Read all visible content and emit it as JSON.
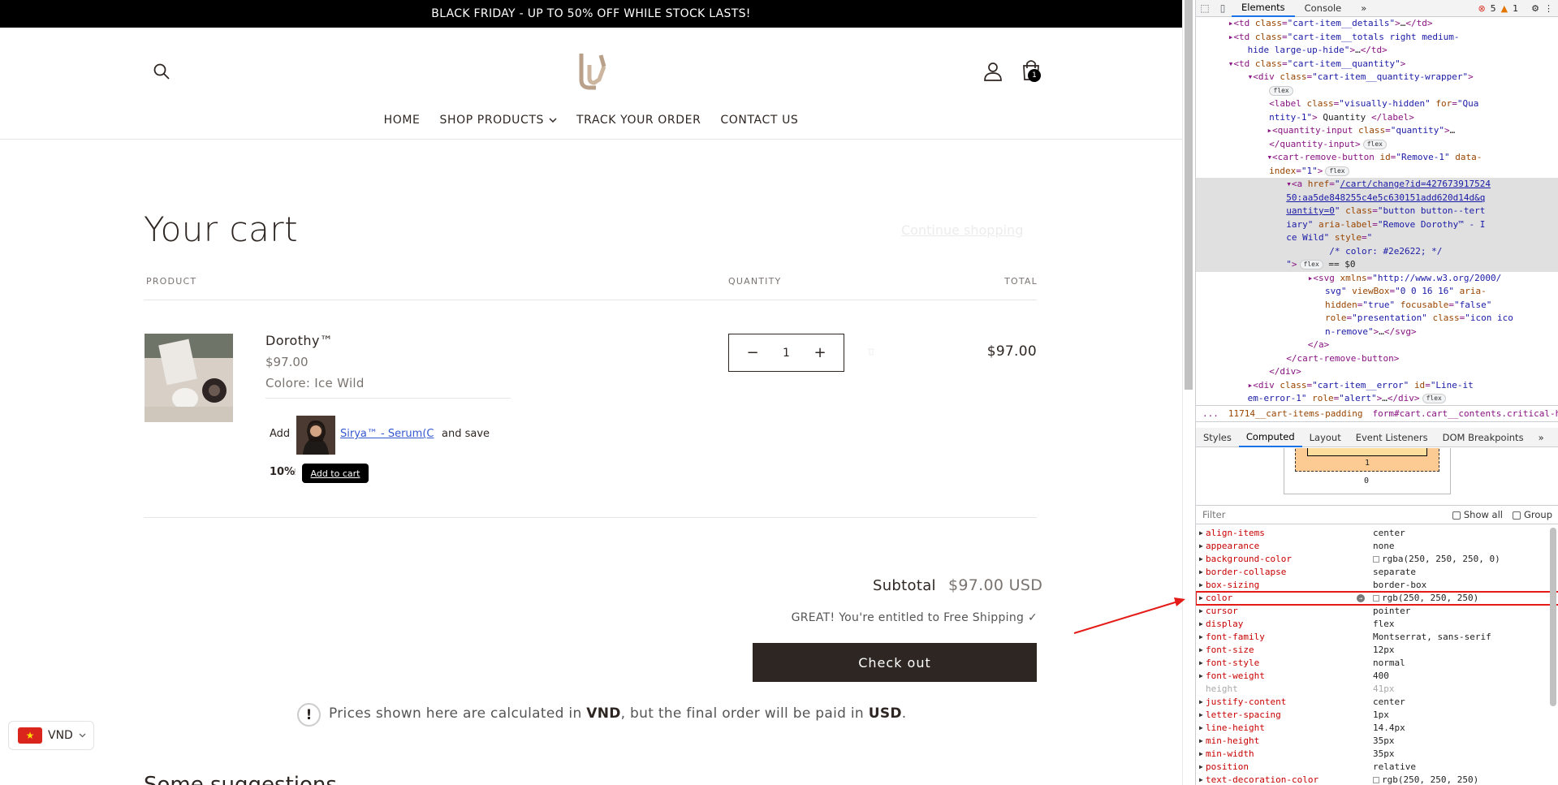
{
  "store": {
    "announcement": "BLACK FRIDAY - UP TO 50% OFF WHILE STOCK LASTS!",
    "nav": [
      "HOME",
      "SHOP PRODUCTS",
      "TRACK YOUR ORDER",
      "CONTACT US"
    ],
    "cart_count": "1",
    "title": "Your cart",
    "continue_shopping": "Continue shopping",
    "headers": {
      "product": "PRODUCT",
      "quantity": "QUANTITY",
      "total": "TOTAL"
    },
    "item": {
      "name": "Dorothy™",
      "price": "$97.00",
      "variant": "Colore: Ice Wild",
      "quantity": "1",
      "line_total": "$97.00"
    },
    "upsell": {
      "add": "Add",
      "product_link": "Sirya™ - Serum(C",
      "and_save": "and save",
      "discount": "10%",
      "separator": "!",
      "button": "Add to cart"
    },
    "subtotal_label": "Subtotal",
    "subtotal_value": "$97.00 USD",
    "shipping_message": "GREAT! You're entitled to Free Shipping ✓",
    "checkout": "Check out",
    "notice": {
      "pre": "Prices shown here are calculated in ",
      "cur1": "VND",
      "mid": ", but the final order will be paid in ",
      "cur2": "USD",
      "end": "."
    },
    "next_heading": "Some suggestions",
    "currency": "VND",
    "colors": {
      "checkout_bg": "#2e2622",
      "announce_bg": "#000000",
      "link": "#3458d0"
    }
  },
  "devtools": {
    "tabs": [
      "Elements",
      "Console"
    ],
    "more_tabs": "»",
    "errors": "5",
    "warnings": "1",
    "dom_lines": [
      {
        "indent": 15,
        "html": "<span class='tri'>▸</span>&lt;td <span class='attr'>class</span>=<span class='val'>\"cart-item__details\"</span>&gt;<span class='plain'>…</span>&lt;/td&gt;"
      },
      {
        "indent": 15,
        "html": "▸&lt;td <span class='attr'>class</span>=<span class='val'>\"cart-item__totals right medium-</span>"
      },
      {
        "indent": 24,
        "html": "<span class='val'>hide large-up-hide\"</span>&gt;<span class='plain'>…</span>&lt;/td&gt;"
      },
      {
        "indent": 15,
        "html": "▾&lt;td <span class='attr'>class</span>=<span class='val'>\"cart-item__quantity\"</span>&gt;"
      },
      {
        "indent": 24,
        "html": "▾&lt;div <span class='attr'>class</span>=<span class='val'>\"cart-item__quantity-wrapper\"</span>&gt;"
      },
      {
        "indent": 33,
        "html": "<span class='pill'>flex</span>"
      },
      {
        "indent": 34,
        "html": "&lt;label <span class='attr'>class</span>=<span class='val'>\"visually-hidden\"</span> <span class='attr'>for</span>=<span class='val'>\"Qua</span>"
      },
      {
        "indent": 34,
        "html": "<span class='val'>ntity-1\"</span>&gt;<span class='plain'> Quantity </span>&lt;/label&gt;"
      },
      {
        "indent": 33,
        "html": "▸&lt;quantity-input <span class='attr'>class</span>=<span class='val'>\"quantity\"</span>&gt;<span class='plain'>…</span>"
      },
      {
        "indent": 34,
        "html": "&lt;/quantity-input&gt;<span class='pill'>flex</span>"
      },
      {
        "indent": 33,
        "html": "▾&lt;cart-remove-button <span class='attr'>id</span>=<span class='val'>\"Remove-1\"</span> <span class='attr'>data-</span>"
      },
      {
        "indent": 34,
        "html": "<span class='attr'>index</span>=<span class='val'>\"1\"</span>&gt;<span class='pill'>flex</span>"
      },
      {
        "indent": 42,
        "sel": true,
        "html": "▾&lt;a <span class='attr'>href</span>=<span class='val'>\"</span><span class='link'>/cart/change?id=427673917524</span>"
      },
      {
        "indent": 42,
        "sel": true,
        "html": "<span class='link'>50:aa5de848255c4e5c630151add620d14d&amp;q</span>"
      },
      {
        "indent": 42,
        "sel": true,
        "html": "<span class='link'>uantity=0</span><span class='val'>\"</span> <span class='attr'>class</span>=<span class='val'>\"button button--tert</span>"
      },
      {
        "indent": 42,
        "sel": true,
        "html": "<span class='val'>iary\"</span> <span class='attr'>aria-label</span>=<span class='val'>\"Remove Dorothy™ - I</span>"
      },
      {
        "indent": 42,
        "sel": true,
        "html": "<span class='val'>ce Wild\"</span> <span class='attr'>style</span>=<span class='val'>\"</span>"
      },
      {
        "indent": 62,
        "sel": true,
        "html": "<span class='val'>/* color: #2e2622; */</span>"
      },
      {
        "indent": 42,
        "sel": true,
        "html": "<span class='val'>\"</span>&gt;<span class='pill'>flex</span><span class='plain'> == $0</span>"
      },
      {
        "indent": 52,
        "html": "▸&lt;svg <span class='attr'>xmlns</span>=<span class='val'>\"http://www.w3.org/2000/</span>"
      },
      {
        "indent": 60,
        "html": "<span class='val'>svg\"</span> <span class='attr'>viewBox</span>=<span class='val'>\"0 0 16 16\"</span> <span class='attr'>aria-</span>"
      },
      {
        "indent": 60,
        "html": "<span class='attr'>hidden</span>=<span class='val'>\"true\"</span> <span class='attr'>focusable</span>=<span class='val'>\"false\"</span>"
      },
      {
        "indent": 60,
        "html": "<span class='attr'>role</span>=<span class='val'>\"presentation\"</span> <span class='attr'>class</span>=<span class='val'>\"icon ico</span>"
      },
      {
        "indent": 60,
        "html": "<span class='val'>n-remove\"</span>&gt;<span class='plain'>…</span>&lt;/svg&gt;"
      },
      {
        "indent": 52,
        "html": "&lt;/a&gt;"
      },
      {
        "indent": 42,
        "html": "&lt;/cart-remove-button&gt;"
      },
      {
        "indent": 34,
        "html": "&lt;/div&gt;"
      },
      {
        "indent": 24,
        "html": "▸&lt;div <span class='attr'>class</span>=<span class='val'>\"cart-item__error\"</span> <span class='attr'>id</span>=<span class='val'>\"Line-it</span>"
      },
      {
        "indent": 24,
        "html": "<span class='val'>em-error-1\"</span> <span class='attr'>role</span>=<span class='val'>\"alert\"</span>&gt;<span class='plain'>…</span>&lt;/div&gt;<span class='pill'>flex</span>"
      }
    ],
    "breadcrumb": [
      "...",
      "11714__cart-items-padding",
      "form#cart.cart__contents.critical-hidden",
      "d",
      "..."
    ],
    "sub_tabs": [
      "Styles",
      "Computed",
      "Layout",
      "Event Listeners",
      "DOM Breakpoints",
      "»"
    ],
    "boxmodel": {
      "inner": "-",
      "padding": "1",
      "bottom": "0"
    },
    "filter_placeholder": "Filter",
    "show_all": "Show all",
    "group": "Group",
    "computed": [
      {
        "name": "align-items",
        "value": "center"
      },
      {
        "name": "appearance",
        "value": "none"
      },
      {
        "name": "background-color",
        "value": "rgba(250, 250, 250, 0)",
        "swatch": true
      },
      {
        "name": "border-collapse",
        "value": "separate"
      },
      {
        "name": "box-sizing",
        "value": "border-box"
      },
      {
        "name": "color",
        "value": "rgb(250, 250, 250)",
        "swatch": true,
        "highlight": true,
        "goto": true
      },
      {
        "name": "cursor",
        "value": "pointer"
      },
      {
        "name": "display",
        "value": "flex"
      },
      {
        "name": "font-family",
        "value": "Montserrat, sans-serif"
      },
      {
        "name": "font-size",
        "value": "12px"
      },
      {
        "name": "font-style",
        "value": "normal"
      },
      {
        "name": "font-weight",
        "value": "400"
      },
      {
        "name": "height",
        "value": "41px",
        "dim": true
      },
      {
        "name": "justify-content",
        "value": "center"
      },
      {
        "name": "letter-spacing",
        "value": "1px"
      },
      {
        "name": "line-height",
        "value": "14.4px"
      },
      {
        "name": "min-height",
        "value": "35px"
      },
      {
        "name": "min-width",
        "value": "35px"
      },
      {
        "name": "position",
        "value": "relative"
      },
      {
        "name": "text-decoration-color",
        "value": "rgb(250, 250, 250)",
        "swatch": true
      }
    ]
  }
}
